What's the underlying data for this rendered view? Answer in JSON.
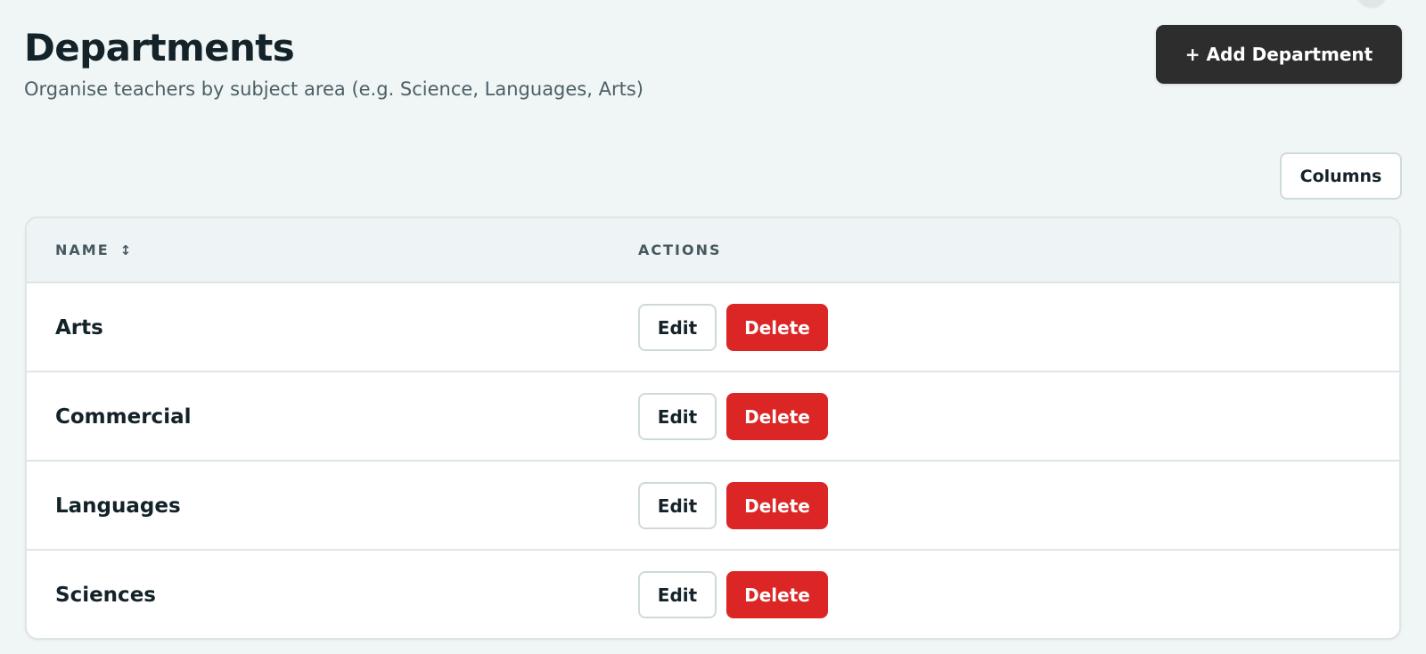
{
  "header": {
    "title": "Departments",
    "subtitle": "Organise teachers by subject area (e.g. Science, Languages, Arts)",
    "add_button_label": "+ Add Department"
  },
  "toolbar": {
    "columns_label": "Columns"
  },
  "table": {
    "columns": [
      {
        "label": "NAME",
        "sortable": true,
        "sort_icon": "sort-icon"
      },
      {
        "label": "ACTIONS"
      }
    ],
    "rows": [
      {
        "name": "Arts",
        "edit_label": "Edit",
        "delete_label": "Delete"
      },
      {
        "name": "Commercial",
        "edit_label": "Edit",
        "delete_label": "Delete"
      },
      {
        "name": "Languages",
        "edit_label": "Edit",
        "delete_label": "Delete"
      },
      {
        "name": "Sciences",
        "edit_label": "Edit",
        "delete_label": "Delete"
      }
    ]
  },
  "colors": {
    "background": "#eff6f5",
    "primary_button": "#2d2d2d",
    "danger": "#dc2626"
  }
}
